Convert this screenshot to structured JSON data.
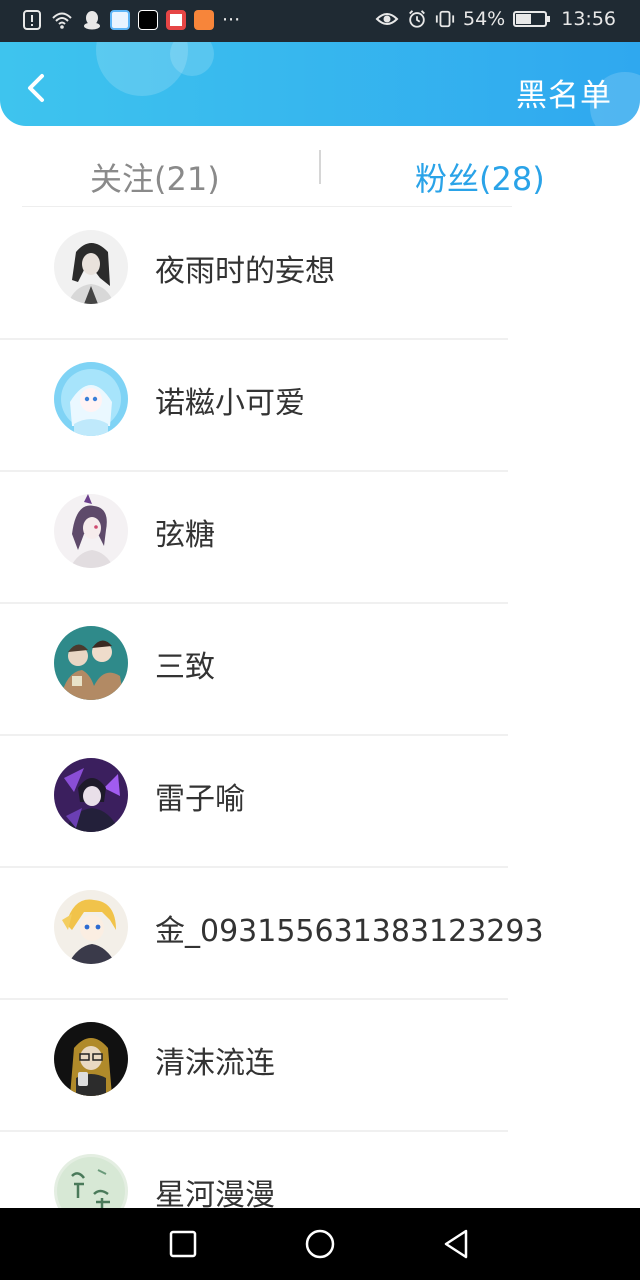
{
  "status_bar": {
    "battery_percent": "54%",
    "battery_level": 0.54,
    "time": "13:56",
    "overflow_glyph": "···",
    "left_icons": [
      "alert-icon",
      "wifi-icon",
      "qq-icon",
      "app-blue-icon",
      "capcut-icon",
      "app-red-icon",
      "app-orange-icon"
    ],
    "right_icons": [
      "eye-icon",
      "alarm-icon",
      "vibrate-icon",
      "battery-icon"
    ]
  },
  "header": {
    "back_icon": "chevron-left-icon",
    "action_label": "黑名单",
    "background_from": "#3ec4ee",
    "background_to": "#2fa8ef"
  },
  "tabs": [
    {
      "label": "关注(21)",
      "active": false
    },
    {
      "label": "粉丝(28)",
      "active": true
    }
  ],
  "accent_color": "#2aa3e8",
  "users": [
    {
      "name": "夜雨时的妄想"
    },
    {
      "name": "诺糍小可爱"
    },
    {
      "name": "弦糖"
    },
    {
      "name": "三致"
    },
    {
      "name": "雷子喻"
    },
    {
      "name": "金_09315563138312329​3"
    },
    {
      "name": "清沫流连"
    },
    {
      "name": "星河漫漫"
    }
  ],
  "nav_bar": {
    "buttons": [
      "recent-apps-icon",
      "home-icon",
      "back-icon"
    ]
  }
}
